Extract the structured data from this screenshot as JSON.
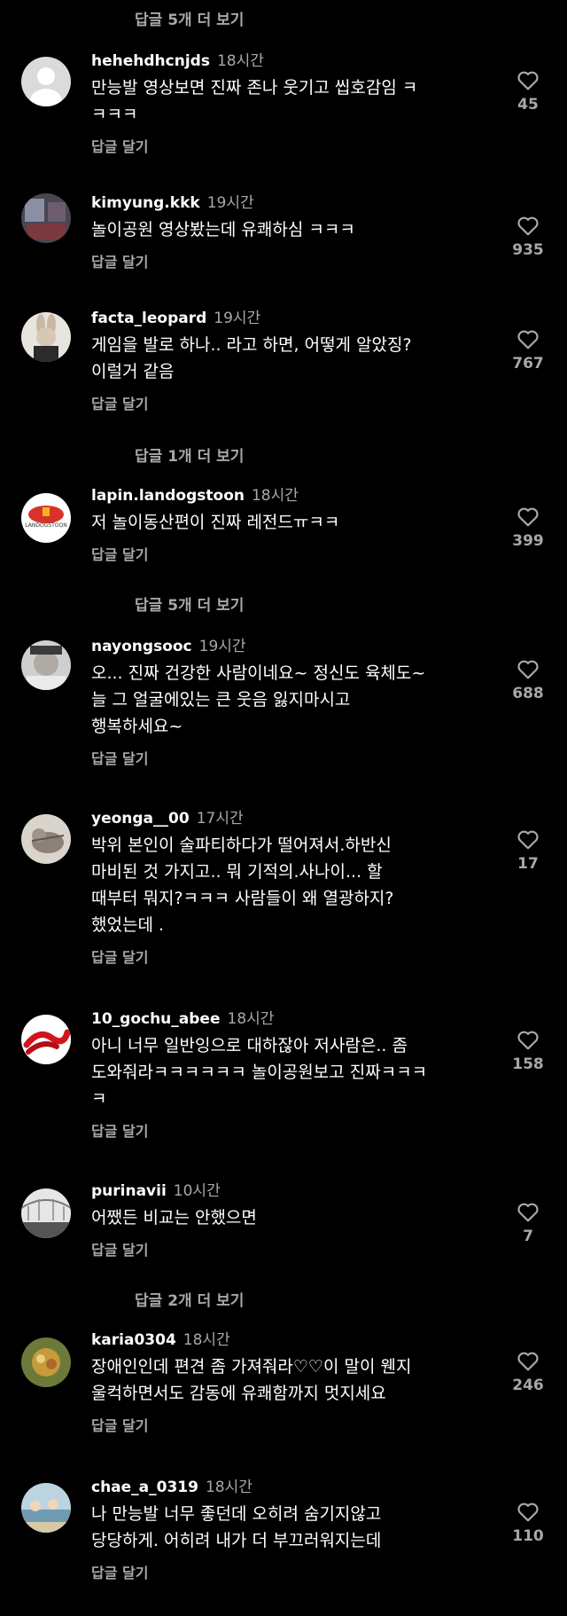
{
  "more_replies": [
    "답글 5개 더 보기",
    "답글 1개 더 보기",
    "답글 5개 더 보기",
    "답글 2개 더 보기"
  ],
  "comments": [
    {
      "user": "hehehdhcnjds",
      "time": "18시간",
      "text": "만능발 영상보면 진짜 존나 웃기고 씹호감임 ㅋ\nㅋㅋㅋ",
      "reply": "답글 달기",
      "likes": "45"
    },
    {
      "user": "kimyung.kkk",
      "time": "19시간",
      "text": "놀이공원 영상봤는데 유쾌하심 ㅋㅋㅋ",
      "reply": "답글 달기",
      "likes": "935"
    },
    {
      "user": "facta_leopard",
      "time": "19시간",
      "text": "게임을 발로 하나.. 라고 하면, 어떻게 알았징?\n이럴거 같음",
      "reply": "답글 달기",
      "likes": "767"
    },
    {
      "user": "lapin.landogstoon",
      "time": "18시간",
      "text": "저 놀이동산편이 진짜 레전드ㅠㅋㅋ",
      "reply": "답글 달기",
      "likes": "399",
      "avatar_text": "LANDOGSTOON"
    },
    {
      "user": "nayongsooc",
      "time": "19시간",
      "text": "오... 진짜 건강한 사람이네요~ 정신도 육체도~\n늘 그 얼굴에있는 큰 웃음 잃지마시고\n행복하세요~",
      "reply": "답글 달기",
      "likes": "688"
    },
    {
      "user": "yeonga__00",
      "time": "17시간",
      "text": "박위 본인이 술파티하다가 떨어져서.하반신\n마비된 것 가지고.. 뭐 기적의.사나이... 할\n때부터  뭐지?ㅋㅋㅋ 사람들이 왜 열광하지?\n했었는데 .",
      "reply": "답글 달기",
      "likes": "17"
    },
    {
      "user": "10_gochu_abee",
      "time": "18시간",
      "text": "아니 너무 일반잉으로 대하잖아 저사람은.. 좀\n도와줘라ㅋㅋㅋㅋㅋㅋ 놀이공원보고 진짜ㅋㅋㅋ\nㅋ",
      "reply": "답글 달기",
      "likes": "158"
    },
    {
      "user": "purinavii",
      "time": "10시간",
      "text": "어쨌든 비교는 안했으면",
      "reply": "답글 달기",
      "likes": "7"
    },
    {
      "user": "karia0304",
      "time": "18시간",
      "text": "장애인인데 편견 좀 가져줘라♡♡이 말이 웬지\n울컥하면서도 감동에 유쾌함까지 멋지세요",
      "reply": "답글 달기",
      "likes": "246"
    },
    {
      "user": "chae_a_0319",
      "time": "18시간",
      "text": "나 만능발 너무 좋던데 오히려 숨기지않고\n당당하게.  어히려 내가 더 부끄러워지는데",
      "reply": "답글 달기",
      "likes": "110"
    }
  ],
  "colors": {
    "background": "#000000",
    "text": "#ffffff",
    "muted": "#a8a8a8"
  }
}
